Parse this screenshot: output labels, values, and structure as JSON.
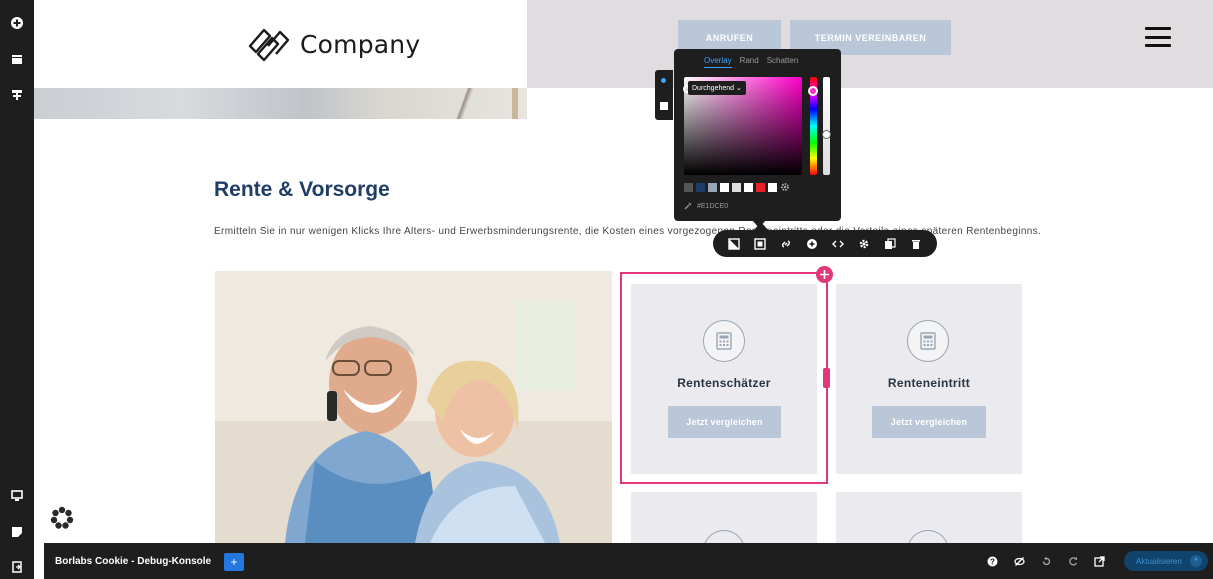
{
  "header": {
    "logo_text": "Company",
    "call_button": "ANRUFEN",
    "appointment_button": "TERMIN VEREINBAREN"
  },
  "content": {
    "title": "Rente & Vorsorge",
    "intro": "Ermitteln Sie in nur wenigen Klicks Ihre Alters- und Erwerbsminderungsrente, die Kosten eines vorgezogenen Renteneintritts oder die Vorteile eines späteren Rentenbeginns."
  },
  "cards": [
    {
      "title": "Rentenschätzer",
      "button": "Jetzt vergleichen"
    },
    {
      "title": "Renteneintritt",
      "button": "Jetzt vergleichen"
    }
  ],
  "picker": {
    "tabs": [
      "Overlay",
      "Rand",
      "Schatten"
    ],
    "active_tab": "Overlay",
    "mode": "Durchgehend",
    "hex_value": "#E1DCE0",
    "swatches": [
      "#555555",
      "#1f3d66",
      "#9aa6b4",
      "#ffffff",
      "#e1dce0",
      "#ffffff",
      "#e8202a",
      "#ffffff"
    ]
  },
  "cookie_bar": {
    "title": "Borlabs Cookie - Debug-Konsole",
    "plus": "+",
    "update_button": "Aktualisieren",
    "update_chevron": "^"
  },
  "colors": {
    "accent_pink": "#e0387a",
    "navy": "#1f3d66",
    "button_blue": "#b9c7d8",
    "header_bg": "#e1dce0"
  }
}
